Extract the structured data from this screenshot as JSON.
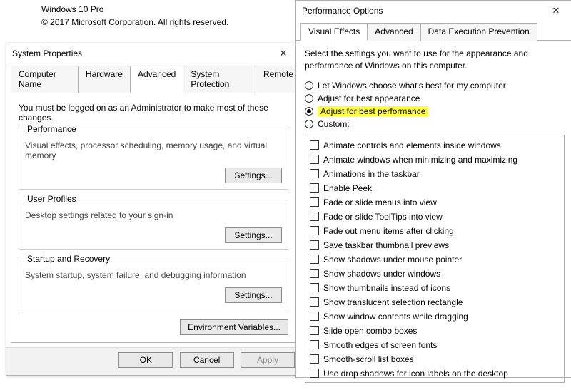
{
  "winver": {
    "edition": "Windows 10 Pro",
    "copyright": "© 2017 Microsoft Corporation. All rights reserved."
  },
  "sysprops": {
    "title": "System Properties",
    "close_glyph": "✕",
    "tabs": {
      "computer_name": "Computer Name",
      "hardware": "Hardware",
      "advanced": "Advanced",
      "system_protection": "System Protection",
      "remote": "Remote"
    },
    "intro": "You must be logged on as an Administrator to make most of these changes.",
    "groups": {
      "performance": {
        "title": "Performance",
        "desc": "Visual effects, processor scheduling, memory usage, and virtual memory",
        "button": "Settings..."
      },
      "user_profiles": {
        "title": "User Profiles",
        "desc": "Desktop settings related to your sign-in",
        "button": "Settings..."
      },
      "startup": {
        "title": "Startup and Recovery",
        "desc": "System startup, system failure, and debugging information",
        "button": "Settings..."
      }
    },
    "env_button": "Environment Variables...",
    "buttons": {
      "ok": "OK",
      "cancel": "Cancel",
      "apply": "Apply"
    }
  },
  "perfopts": {
    "title": "Performance Options",
    "close_glyph": "✕",
    "tabs": {
      "visual_effects": "Visual Effects",
      "advanced": "Advanced",
      "dep": "Data Execution Prevention"
    },
    "intro": "Select the settings you want to use for the appearance and performance of Windows on this computer.",
    "radios": {
      "auto": "Let Windows choose what's best for my computer",
      "appearance": "Adjust for best appearance",
      "performance": "Adjust for best performance",
      "custom": "Custom:"
    },
    "checks": [
      "Animate controls and elements inside windows",
      "Animate windows when minimizing and maximizing",
      "Animations in the taskbar",
      "Enable Peek",
      "Fade or slide menus into view",
      "Fade or slide ToolTips into view",
      "Fade out menu items after clicking",
      "Save taskbar thumbnail previews",
      "Show shadows under mouse pointer",
      "Show shadows under windows",
      "Show thumbnails instead of icons",
      "Show translucent selection rectangle",
      "Show window contents while dragging",
      "Slide open combo boxes",
      "Smooth edges of screen fonts",
      "Smooth-scroll list boxes",
      "Use drop shadows for icon labels on the desktop"
    ]
  }
}
